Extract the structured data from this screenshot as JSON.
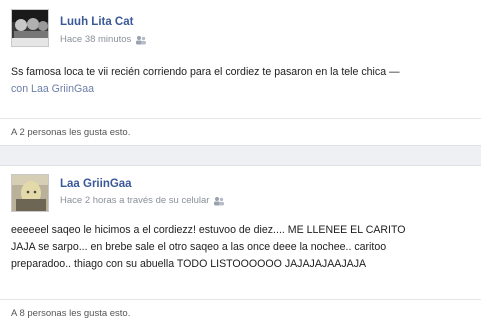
{
  "post1": {
    "author": "Luuh Lita Cat",
    "time": "Hace 38 minutos",
    "audience_icon": "people-icon",
    "text": "Ss famosa loca te vii recién corriendo para el cordiez te pasaron en la tele chica —",
    "with_prefix": "con",
    "with_name": "Laa GriinGaa",
    "likes": "A 2 personas les gusta esto."
  },
  "post2": {
    "author": "Laa GriinGaa",
    "time": "Hace 2 horas a través de su celular",
    "audience_icon": "people-icon",
    "text_line1": "eeeeeel saqeo le hicimos a el cordiezz! estuvoo de diez.... ME LLENEE EL CARITO",
    "text_line2": "JAJA se sarpo... en brebe sale el otro saqeo a las once deee la nochee.. caritoo",
    "text_line3": "preparadoo.. thiago con su abuella TODO LISTOOOOOO JAJAJAJAAJAJA",
    "likes": "A 8 personas les gusta esto."
  }
}
